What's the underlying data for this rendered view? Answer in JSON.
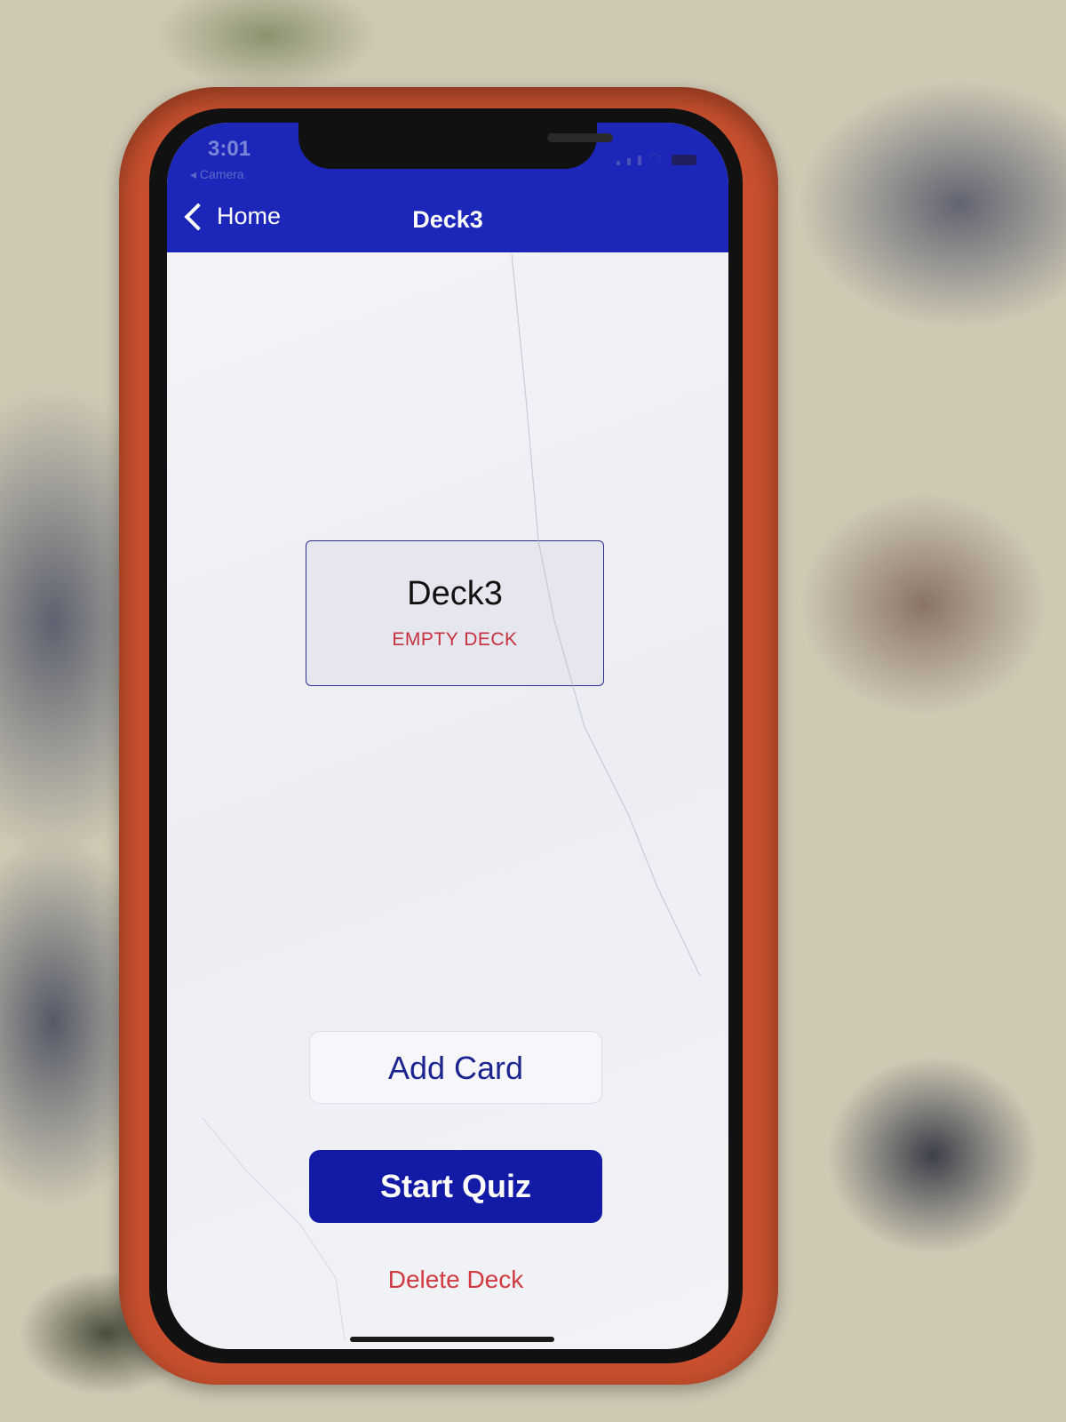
{
  "status_bar": {
    "time": "3:01",
    "back_app": "◂ Camera",
    "wifi_icon": "wifi-icon",
    "battery_icon": "battery-icon"
  },
  "nav": {
    "back_label": "Home",
    "title": "Deck3"
  },
  "deck": {
    "name": "Deck3",
    "status": "EMPTY DECK"
  },
  "actions": {
    "add_card": "Add Card",
    "start_quiz": "Start Quiz",
    "delete_deck": "Delete Deck"
  },
  "colors": {
    "header": "#1c26b8",
    "primary_button": "#131aa5",
    "danger": "#d03a40",
    "case": "#c8502e"
  }
}
